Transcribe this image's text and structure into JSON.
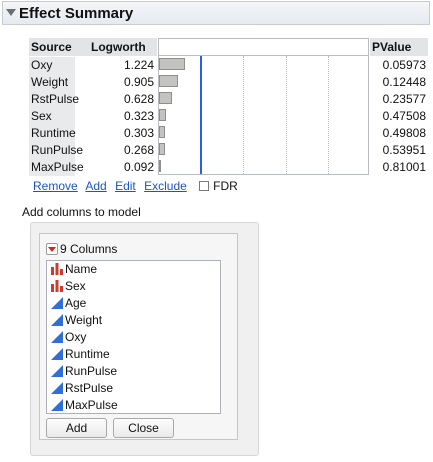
{
  "outline": {
    "title": "Effect Summary"
  },
  "table": {
    "headers": {
      "source": "Source",
      "logworth": "Logworth",
      "pvalue": "PValue"
    },
    "rows": [
      {
        "source": "Oxy",
        "logworth": "1.224",
        "pvalue": "0.05973",
        "logworth_value": 1.224
      },
      {
        "source": "Weight",
        "logworth": "0.905",
        "pvalue": "0.12448",
        "logworth_value": 0.905
      },
      {
        "source": "RstPulse",
        "logworth": "0.628",
        "pvalue": "0.23577",
        "logworth_value": 0.628
      },
      {
        "source": "Sex",
        "logworth": "0.323",
        "pvalue": "0.47508",
        "logworth_value": 0.323
      },
      {
        "source": "Runtime",
        "logworth": "0.303",
        "pvalue": "0.49808",
        "logworth_value": 0.303
      },
      {
        "source": "RunPulse",
        "logworth": "0.268",
        "pvalue": "0.53951",
        "logworth_value": 0.268
      },
      {
        "source": "MaxPulse",
        "logworth": "0.092",
        "pvalue": "0.81001",
        "logworth_value": 0.092
      }
    ],
    "plot_max_logworth": 10,
    "reference_logworth": 2,
    "colors": {
      "bar": "#c3c3c1",
      "reference_line": "#2a5fe3"
    }
  },
  "actions": {
    "remove": "Remove",
    "add": "Add",
    "edit": "Edit",
    "exclude": "Exclude",
    "fdr": "FDR"
  },
  "add_columns": {
    "title": "Add columns to model",
    "header": "9 Columns",
    "columns": [
      {
        "name": "Name",
        "icon": "nominal-icon"
      },
      {
        "name": "Sex",
        "icon": "nominal-icon"
      },
      {
        "name": "Age",
        "icon": "continuous-icon"
      },
      {
        "name": "Weight",
        "icon": "continuous-icon"
      },
      {
        "name": "Oxy",
        "icon": "continuous-icon"
      },
      {
        "name": "Runtime",
        "icon": "continuous-icon"
      },
      {
        "name": "RunPulse",
        "icon": "continuous-icon"
      },
      {
        "name": "RstPulse",
        "icon": "continuous-icon"
      },
      {
        "name": "MaxPulse",
        "icon": "continuous-icon"
      }
    ],
    "add_button": "Add",
    "close_button": "Close"
  }
}
